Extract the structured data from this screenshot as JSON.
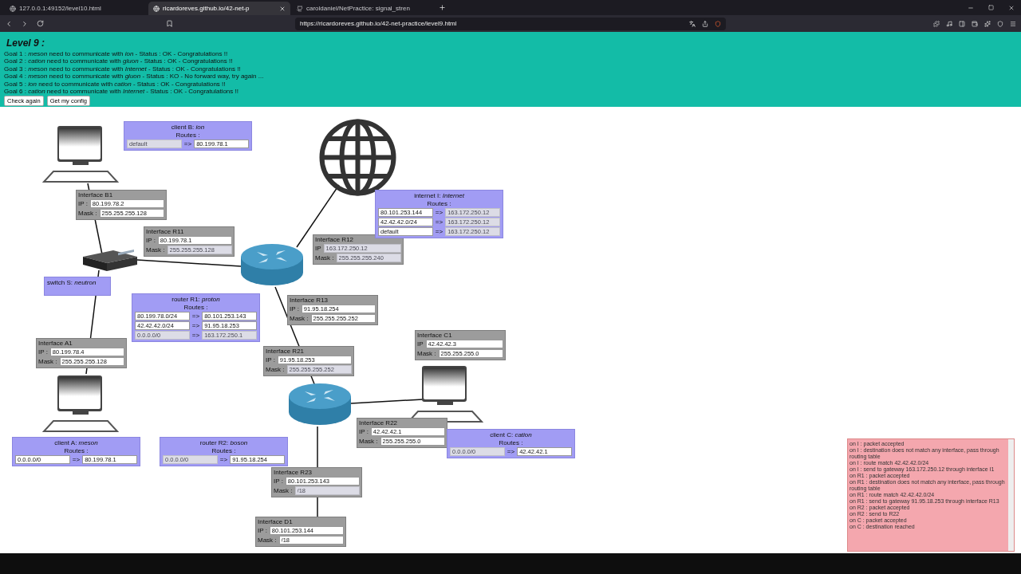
{
  "browser": {
    "tabs": [
      {
        "label": "127.0.0.1:49152/level10.html",
        "selected": false
      },
      {
        "label": "ricardoreves.github.io/42-net-p",
        "selected": true
      },
      {
        "label": "caroldaniel/NetPractice: signal_stren",
        "selected": false
      }
    ],
    "url": "https://ricardoreves.github.io/42-net-practice/level9.html"
  },
  "level_title": "Level 9 :",
  "goals": [
    {
      "text": "Goal 1 : *meson* need to communicate with *ion* - Status : OK - Congratulations !!"
    },
    {
      "text": "Goal 2 : *cation* need to communicate with *gluon* - Status : OK - Congratulations !!"
    },
    {
      "text": "Goal 3 : *meson* need to communicate with *Internet* - Status : OK - Congratulations !!"
    },
    {
      "text": "Goal 4 : *meson* need to communicate with *gluon* - Status : KO - No forward way, try again ..."
    },
    {
      "text": "Goal 5 : *ion* need to communicate with *cation* - Status : OK - Congratulations !!"
    },
    {
      "text": "Goal 6 : *cation* need to communicate with *Internet* - Status : OK - Congratulations !!"
    }
  ],
  "buttons": [
    "Check again",
    "Get my config"
  ],
  "nodes": [
    {
      "kind": "computer"
    },
    {
      "kind": "internet"
    },
    {
      "kind": "switch"
    },
    {
      "kind": "router"
    },
    {
      "kind": "computer"
    },
    {
      "kind": "computer"
    },
    {
      "kind": "router"
    }
  ],
  "hosts": [
    {
      "title": "client B: *ion*",
      "routes_label": "Routes :",
      "routes": [
        {
          "destination": {
            "value": "default",
            "disabled": true
          },
          "separator": "=>",
          "gateway": {
            "value": "80.199.78.1",
            "disabled": false
          }
        }
      ]
    },
    {
      "title": "internet I: *Internet*",
      "routes_label": "Routes :",
      "routes": [
        {
          "destination": {
            "value": "80.101.253.144",
            "disabled": false
          },
          "separator": "=>",
          "gateway": {
            "value": "163.172.250.12",
            "disabled": true
          }
        },
        {
          "destination": {
            "value": "42.42.42.0/24",
            "disabled": false
          },
          "separator": "=>",
          "gateway": {
            "value": "163.172.250.12",
            "disabled": true
          }
        },
        {
          "destination": {
            "value": "default",
            "disabled": false
          },
          "separator": "=>",
          "gateway": {
            "value": "163.172.250.12",
            "disabled": true
          }
        }
      ]
    },
    {
      "title": "switch S: *neutron*"
    },
    {
      "title": "router R1: *proton*",
      "routes_label": "Routes :",
      "routes": [
        {
          "destination": {
            "value": "80.199.78.0/24",
            "disabled": false
          },
          "separator": "=>",
          "gateway": {
            "value": "80.101.253.143",
            "disabled": false
          }
        },
        {
          "destination": {
            "value": "42.42.42.0/24",
            "disabled": false
          },
          "separator": "=>",
          "gateway": {
            "value": "91.95.18.253",
            "disabled": false
          }
        },
        {
          "destination": {
            "value": "0.0.0.0/0",
            "disabled": true
          },
          "separator": "=>",
          "gateway": {
            "value": "163.172.250.1",
            "disabled": true
          }
        }
      ]
    },
    {
      "title": "client A: *meson*",
      "routes_label": "Routes :",
      "routes": [
        {
          "destination": {
            "value": "0.0.0.0/0",
            "disabled": false
          },
          "separator": "=>",
          "gateway": {
            "value": "80.199.78.1",
            "disabled": false
          }
        }
      ]
    },
    {
      "title": "router R2: *boson*",
      "routes_label": "Routes :",
      "routes": [
        {
          "destination": {
            "value": "0.0.0.0/0",
            "disabled": true
          },
          "separator": "=>",
          "gateway": {
            "value": "91.95.18.254",
            "disabled": false
          }
        }
      ]
    },
    {
      "title": "client C: *cation*",
      "routes_label": "Routes :",
      "routes": [
        {
          "destination": {
            "value": "0.0.0.0/0",
            "disabled": true
          },
          "separator": "=>",
          "gateway": {
            "value": "42.42.42.1",
            "disabled": false
          }
        }
      ]
    }
  ],
  "interfaces": [
    {
      "name": "Interface B1",
      "ip": {
        "label": "IP :",
        "value": "80.199.78.2",
        "disabled": false
      },
      "mask": {
        "label": "Mask :",
        "value": "255.255.255.128",
        "disabled": false
      }
    },
    {
      "name": "Interface R11",
      "ip": {
        "label": "IP :",
        "value": "80.199.78.1",
        "disabled": false
      },
      "mask": {
        "label": "Mask :",
        "value": "255.255.255.128",
        "disabled": true
      }
    },
    {
      "name": "Interface R12",
      "ip": {
        "label": "IP",
        "value": "163.172.250.12",
        "disabled": true
      },
      "mask": {
        "label": "Mask :",
        "value": "255.255.255.240",
        "disabled": true
      }
    },
    {
      "name": "Interface R13",
      "ip": {
        "label": "IP :",
        "value": "91.95.18.254",
        "disabled": false
      },
      "mask": {
        "label": "Mask :",
        "value": "255.255.255.252",
        "disabled": false
      }
    },
    {
      "name": "Interface A1",
      "ip": {
        "label": "IP :",
        "value": "80.199.78.4",
        "disabled": false
      },
      "mask": {
        "label": "Mask :",
        "value": "255.255.255.128",
        "disabled": false
      }
    },
    {
      "name": "Interface C1",
      "ip": {
        "label": "IP",
        "value": "42.42.42.3",
        "disabled": false
      },
      "mask": {
        "label": "Mask :",
        "value": "255.255.255.0",
        "disabled": false
      }
    },
    {
      "name": "Interface R21",
      "ip": {
        "label": "IP :",
        "value": "91.95.18.253",
        "disabled": false
      },
      "mask": {
        "label": "Mask :",
        "value": "255.255.255.252",
        "disabled": true
      }
    },
    {
      "name": "Interface R22",
      "ip": {
        "label": "IP :",
        "value": "42.42.42.1",
        "disabled": false
      },
      "mask": {
        "label": "Mask :",
        "value": "255.255.255.0",
        "disabled": false
      }
    },
    {
      "name": "Interface R23",
      "ip": {
        "label": "IP :",
        "value": "80.101.253.143",
        "disabled": false
      },
      "mask": {
        "label": "Mask :",
        "value": "/18",
        "disabled": true
      }
    },
    {
      "name": "Interface D1",
      "ip": {
        "label": "IP :",
        "value": "80.101.253.144",
        "disabled": false
      },
      "mask": {
        "label": "Mask :",
        "value": "/18",
        "disabled": false
      }
    }
  ],
  "log": [
    "on I : packet accepted",
    "on I : destination does not match any interface, pass through routing table",
    "on I : route match 42.42.42.0/24",
    "on I : send to gateway 163.172.250.12 through interface I1",
    "on R1 : packet accepted",
    "on R1 : destination does not match any interface, pass through routing table",
    "on R1 : route match 42.42.42.0/24",
    "on R1 : send to gateway 91.95.18.253 through interface R13",
    "on R2 : packet accepted",
    "on R2 : send to R22",
    "on C : packet accepted",
    "on C : destination reached"
  ]
}
